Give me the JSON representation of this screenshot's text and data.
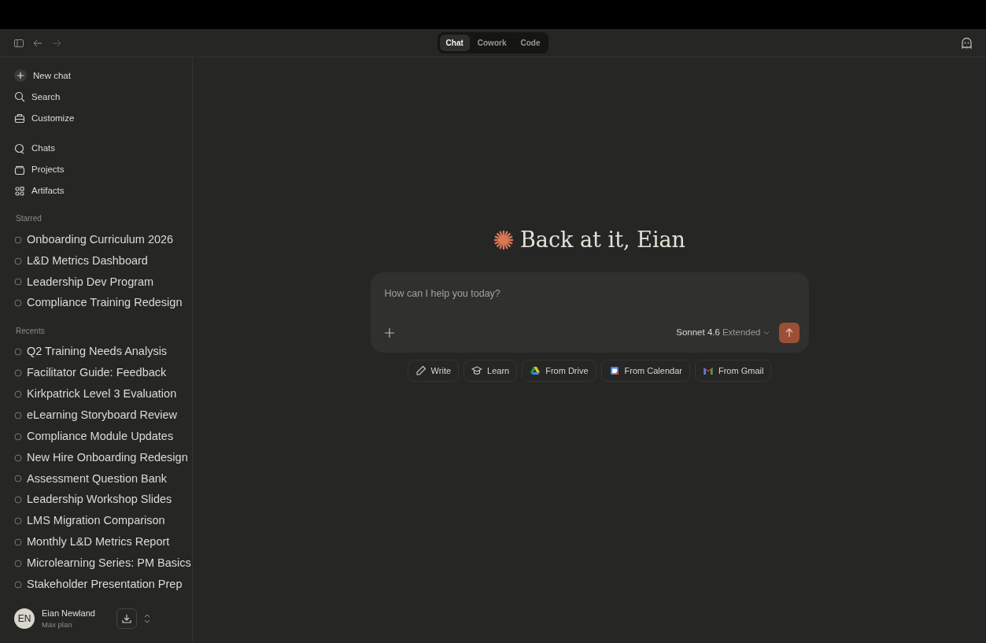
{
  "mode_tabs": [
    {
      "label": "Chat",
      "selected": true
    },
    {
      "label": "Cowork",
      "selected": false
    },
    {
      "label": "Code",
      "selected": false
    }
  ],
  "sidebar": {
    "actions": [
      {
        "label": "New chat",
        "kind": "new"
      },
      {
        "label": "Search",
        "kind": "search"
      },
      {
        "label": "Customize",
        "kind": "customize"
      }
    ],
    "nav": [
      {
        "label": "Chats",
        "kind": "chats"
      },
      {
        "label": "Projects",
        "kind": "projects"
      },
      {
        "label": "Artifacts",
        "kind": "artifacts"
      }
    ],
    "starred": {
      "heading": "Starred",
      "items": [
        "Onboarding Curriculum 2026",
        "L&D Metrics Dashboard",
        "Leadership Dev Program",
        "Compliance Training Redesign"
      ]
    },
    "recents": {
      "heading": "Recents",
      "items": [
        "Q2 Training Needs Analysis",
        "Facilitator Guide: Feedback",
        "Kirkpatrick Level 3 Evaluation",
        "eLearning Storyboard Review",
        "Compliance Module Updates",
        "New Hire Onboarding Redesign",
        "Assessment Question Bank",
        "Leadership Workshop Slides",
        "LMS Migration Comparison",
        "Monthly L&D Metrics Report",
        "Microlearning Series: PM Basics",
        "Stakeholder Presentation Prep"
      ]
    },
    "user": {
      "initials": "EN",
      "name": "Eian Newland",
      "plan": "Max plan"
    }
  },
  "greeting": "Back at it, Eian",
  "composer": {
    "placeholder": "How can I help you today?",
    "model": "Sonnet 4.6",
    "mode": "Extended"
  },
  "chips": [
    {
      "label": "Write",
      "kind": "write"
    },
    {
      "label": "Learn",
      "kind": "learn"
    },
    {
      "label": "From Drive",
      "kind": "drive"
    },
    {
      "label": "From Calendar",
      "kind": "calendar"
    },
    {
      "label": "From Gmail",
      "kind": "gmail"
    }
  ]
}
